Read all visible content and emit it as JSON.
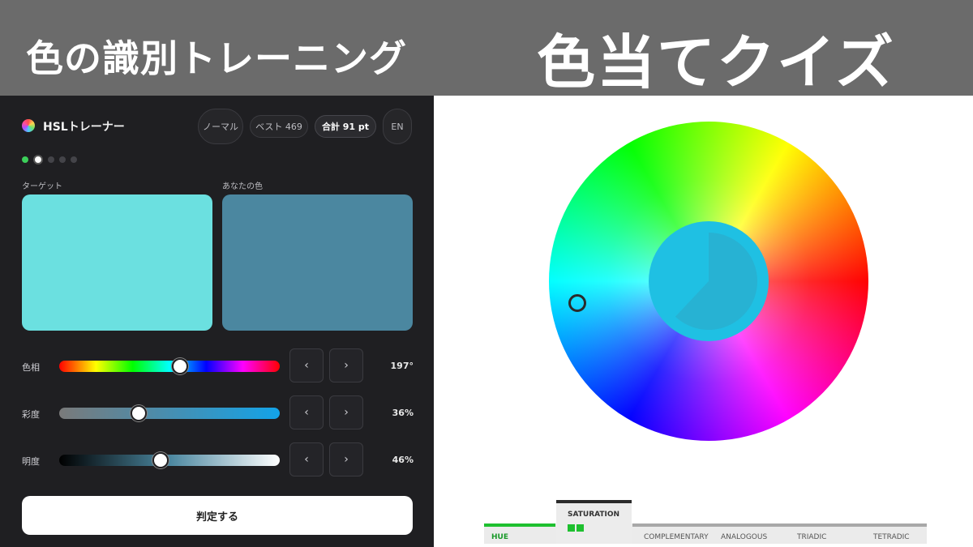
{
  "banner": {
    "title": "色の識別トレーニング",
    "title_big": "色当てクイズ"
  },
  "app": {
    "title": "HSLトレーナー",
    "mode_label": "ノーマル",
    "best_label": "ベスト 469",
    "total_label": "合計 91 pt",
    "lang_label": "EN",
    "progress": {
      "total": 5,
      "completed": 1,
      "current_index": 1
    }
  },
  "swatches": {
    "target_label": "ターゲット",
    "target_color": "#6be0e0",
    "yours_label": "あなたの色",
    "yours_color": "#4b87a0"
  },
  "sliders": [
    {
      "label": "色相",
      "value_text": "197°",
      "value": 197,
      "max": 360,
      "prev": "‹",
      "next": "›"
    },
    {
      "label": "彩度",
      "value_text": "36%",
      "value": 36,
      "max": 100,
      "prev": "‹",
      "next": "›"
    },
    {
      "label": "明度",
      "value_text": "46%",
      "value": 46,
      "max": 100,
      "prev": "‹",
      "next": "›"
    }
  ],
  "submit_label": "判定する",
  "wheel": {
    "center_color": "#1fc0e3",
    "pie_color": "#27b2d3",
    "pie_fraction": 0.62
  },
  "modes": {
    "hue": "HUE",
    "saturation": "SATURATION",
    "complementary": "COMPLEMENTARY",
    "analogous": "ANALOGOUS",
    "triadic": "TRIADIC",
    "tetradic": "TETRADIC"
  },
  "colors": {
    "accent_green": "#1ec02f",
    "panel_bg": "#1f1f22"
  }
}
